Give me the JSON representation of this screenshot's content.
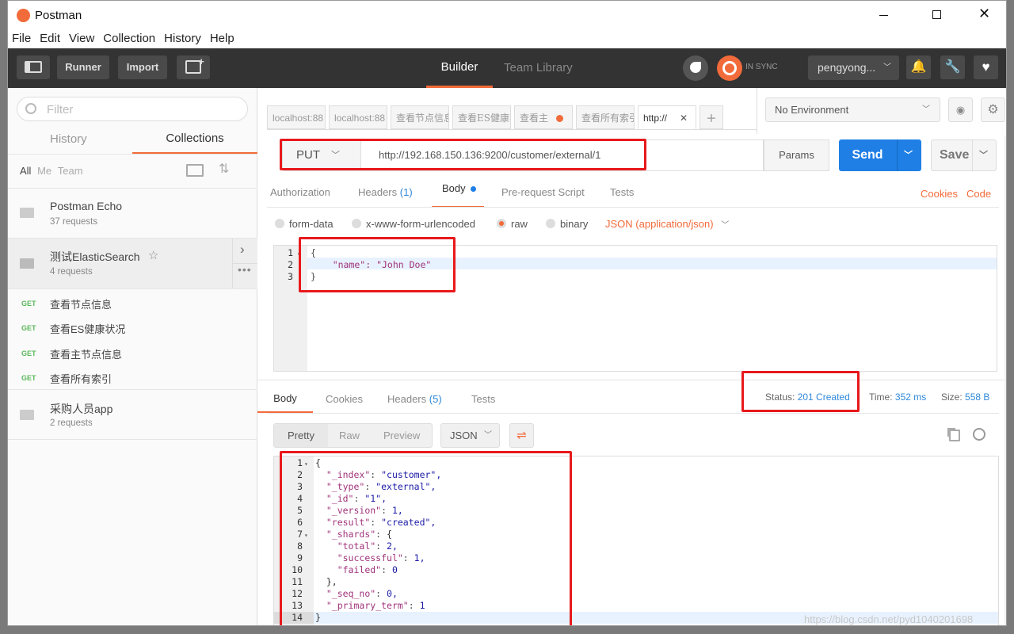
{
  "window": {
    "title": "Postman"
  },
  "menu": [
    "File",
    "Edit",
    "View",
    "Collection",
    "History",
    "Help"
  ],
  "toolbar": {
    "runner": "Runner",
    "import": "Import",
    "builder": "Builder",
    "team_library": "Team Library",
    "sync": "IN SYNC",
    "user": "pengyong..."
  },
  "sidebar": {
    "filter_placeholder": "Filter",
    "tabs": [
      "History",
      "Collections"
    ],
    "filters": [
      "All",
      "Me",
      "Team"
    ],
    "collections": [
      {
        "name": "Postman Echo",
        "count": "37 requests"
      },
      {
        "name": "测试ElasticSearch",
        "count": "4 requests"
      },
      {
        "name": "采购人员app",
        "count": "2 requests"
      }
    ],
    "requests": [
      {
        "method": "GET",
        "name": "查看节点信息"
      },
      {
        "method": "GET",
        "name": "查看ES健康状况"
      },
      {
        "method": "GET",
        "name": "查看主节点信息"
      },
      {
        "method": "GET",
        "name": "查看所有索引"
      }
    ]
  },
  "request_tabs": [
    "localhost:88",
    "localhost:88",
    "查看节点信息",
    "查看ES健康状",
    "查看主",
    "查看所有索引",
    "http://"
  ],
  "environment": "No Environment",
  "request": {
    "method": "PUT",
    "url": "http://192.168.150.136:9200/customer/external/1",
    "params": "Params",
    "send": "Send",
    "save": "Save",
    "tabs": {
      "authorization": "Authorization",
      "headers": "Headers",
      "headers_count": "(1)",
      "body": "Body",
      "prerequest": "Pre-request Script",
      "tests": "Tests"
    },
    "cookies": "Cookies",
    "code": "Code",
    "body_types": [
      "form-data",
      "x-www-form-urlencoded",
      "raw",
      "binary"
    ],
    "content_type": "JSON (application/json)",
    "body_lines": [
      "{",
      "    \"name\": \"John Doe\"",
      "}"
    ]
  },
  "response": {
    "tabs": {
      "body": "Body",
      "cookies": "Cookies",
      "headers": "Headers",
      "headers_count": "(5)",
      "tests": "Tests"
    },
    "status_label": "Status:",
    "status": "201 Created",
    "time_label": "Time:",
    "time": "352 ms",
    "size_label": "Size:",
    "size": "558 B",
    "views": [
      "Pretty",
      "Raw",
      "Preview"
    ],
    "format": "JSON",
    "lines": [
      "{",
      "  \"_index\": \"customer\",",
      "  \"_type\": \"external\",",
      "  \"_id\": \"1\",",
      "  \"_version\": 1,",
      "  \"result\": \"created\",",
      "  \"_shards\": {",
      "    \"total\": 2,",
      "    \"successful\": 1,",
      "    \"failed\": 0",
      "  },",
      "  \"_seq_no\": 0,",
      "  \"_primary_term\": 1",
      "}"
    ]
  },
  "watermark": "https://blog.csdn.net/pyd1040201698",
  "colors": {
    "accent": "#f26b3a",
    "send": "#1f7fe5",
    "status": "#2e88d9",
    "highlight": "#e8191c"
  }
}
